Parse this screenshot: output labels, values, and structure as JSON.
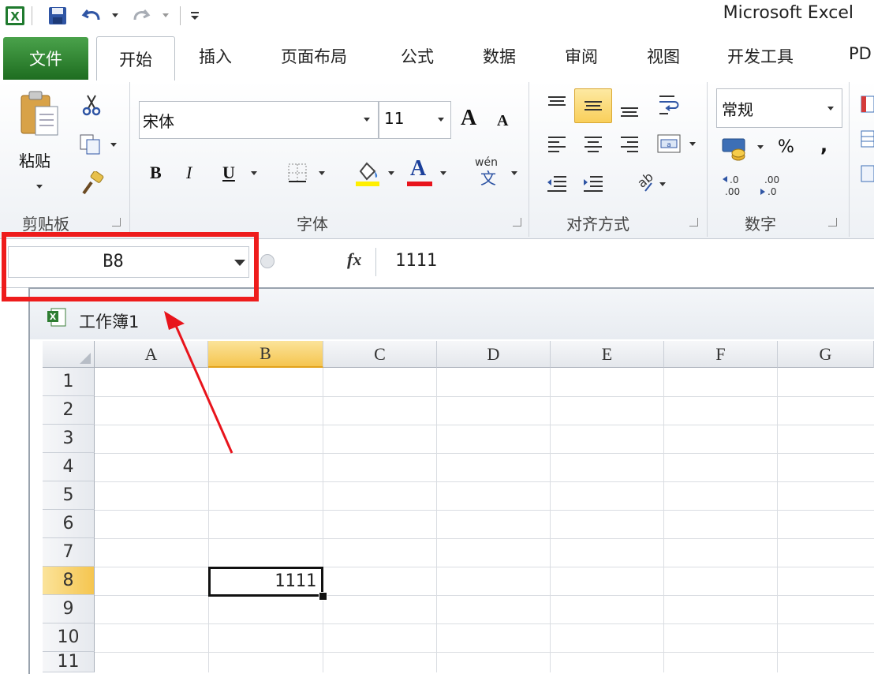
{
  "app": {
    "title": "Microsoft Excel"
  },
  "ribbon_tabs": {
    "file": "文件",
    "home": "开始",
    "insert": "插入",
    "page_layout": "页面布局",
    "formulas": "公式",
    "data": "数据",
    "review": "审阅",
    "view": "视图",
    "developer": "开发工具",
    "pdf": "PD"
  },
  "clipboard": {
    "paste_label": "粘贴",
    "group_label": "剪贴板"
  },
  "font": {
    "name": "宋体",
    "size": "11",
    "group_label": "字体",
    "bold": "B",
    "italic": "I",
    "underline": "U",
    "grow": "A",
    "shrink": "A",
    "font_color": "A",
    "phonetic": "wén"
  },
  "alignment": {
    "group_label": "对齐方式"
  },
  "number": {
    "format": "常规",
    "percent": "%",
    "comma": ",",
    "inc_decimal": "←.0\n.00",
    "dec_decimal": ".00\n→.0",
    "group_label": "数字"
  },
  "formula_bar": {
    "name_box": "B8",
    "fx": "fx",
    "value": "1111"
  },
  "workbook": {
    "title": "工作簿1"
  },
  "grid": {
    "columns": [
      "A",
      "B",
      "C",
      "D",
      "E",
      "F",
      "G"
    ],
    "rows": [
      "1",
      "2",
      "3",
      "4",
      "5",
      "6",
      "7",
      "8",
      "9",
      "10",
      "11"
    ],
    "selected_column": "B",
    "selected_row": "8",
    "cell_b8": "1111"
  },
  "colors": {
    "file_tab": "#2b7a2d",
    "annotation_red": "#ee1c1c",
    "selection_header": "#f5c54f"
  }
}
